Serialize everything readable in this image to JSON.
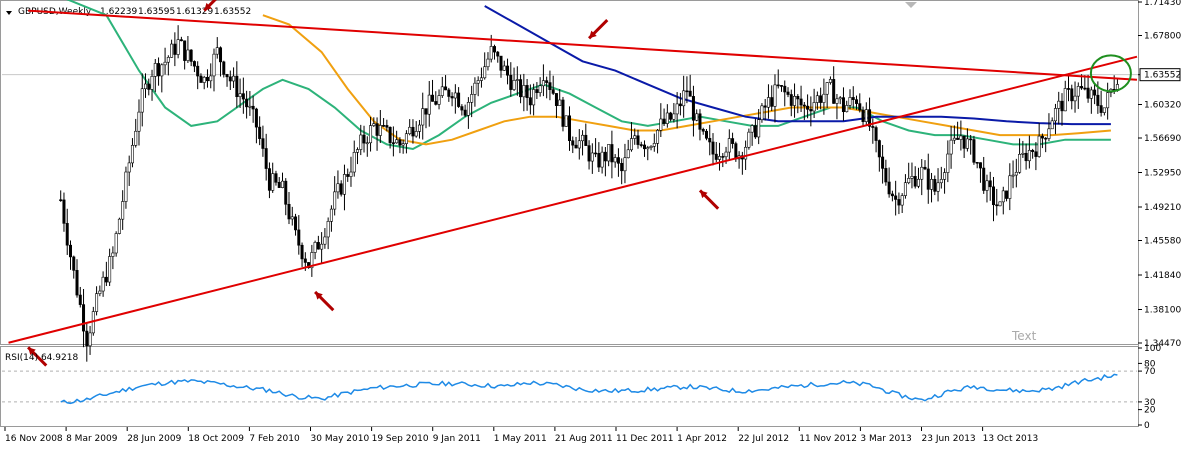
{
  "header": {
    "symbol": "GBPUSD,Weekly",
    "open": "1.62239",
    "high": "1.63595",
    "low": "1.61329",
    "close": "1.63552",
    "watermark": "Text"
  },
  "colors": {
    "background": "#ffffff",
    "bull_candle": "#000000",
    "bear_candle": "#000000",
    "trendline": "#e00000",
    "ma_fast": "#2db37a",
    "ma_mid": "#f0a010",
    "ma_slow": "#0a1aa8",
    "rsi_line": "#1e8ae6",
    "arrow": "#b00000",
    "highlight_circle": "#1f8f1f",
    "price_marker": "#ffffff"
  },
  "chart_data": [
    {
      "type": "candlestick",
      "title": "GBPUSD,Weekly",
      "ohlc_header": {
        "open": 1.62239,
        "high": 1.63595,
        "low": 1.61329,
        "close": 1.63552
      },
      "ylim": [
        1.3447,
        1.7143
      ],
      "y_ticks": [
        "1.71430",
        "1.67800",
        "1.63552",
        "1.60320",
        "1.56690",
        "1.52950",
        "1.49210",
        "1.45580",
        "1.41840",
        "1.38100",
        "1.34470"
      ],
      "current_price_label": "1.63552",
      "x_ticks": [
        "16 Nov 2008",
        "8 Mar 2009",
        "28 Jun 2009",
        "18 Oct 2009",
        "7 Feb 2010",
        "30 May 2010",
        "19 Sep 2010",
        "9 Jan 2011",
        "1 May 2011",
        "21 Aug 2011",
        "11 Dec 2011",
        "1 Apr 2012",
        "22 Jul 2012",
        "11 Nov 2012",
        "3 Mar 2013",
        "23 Jun 2013",
        "13 Oct 2013"
      ],
      "price_path": [
        [
          0,
          1.5
        ],
        [
          4,
          1.42
        ],
        [
          8,
          1.35
        ],
        [
          12,
          1.4
        ],
        [
          16,
          1.44
        ],
        [
          20,
          1.52
        ],
        [
          24,
          1.6
        ],
        [
          28,
          1.64
        ],
        [
          32,
          1.65
        ],
        [
          36,
          1.67
        ],
        [
          40,
          1.65
        ],
        [
          44,
          1.63
        ],
        [
          48,
          1.66
        ],
        [
          52,
          1.63
        ],
        [
          56,
          1.61
        ],
        [
          60,
          1.58
        ],
        [
          64,
          1.52
        ],
        [
          68,
          1.51
        ],
        [
          72,
          1.46
        ],
        [
          76,
          1.43
        ],
        [
          80,
          1.46
        ],
        [
          84,
          1.5
        ],
        [
          88,
          1.53
        ],
        [
          92,
          1.56
        ],
        [
          96,
          1.58
        ],
        [
          100,
          1.57
        ],
        [
          104,
          1.56
        ],
        [
          108,
          1.58
        ],
        [
          112,
          1.6
        ],
        [
          116,
          1.61
        ],
        [
          120,
          1.62
        ],
        [
          124,
          1.6
        ],
        [
          128,
          1.63
        ],
        [
          132,
          1.66
        ],
        [
          136,
          1.64
        ],
        [
          140,
          1.62
        ],
        [
          144,
          1.61
        ],
        [
          148,
          1.64
        ],
        [
          152,
          1.61
        ],
        [
          156,
          1.57
        ],
        [
          160,
          1.56
        ],
        [
          164,
          1.54
        ],
        [
          168,
          1.55
        ],
        [
          172,
          1.53
        ],
        [
          176,
          1.57
        ],
        [
          180,
          1.56
        ],
        [
          184,
          1.58
        ],
        [
          188,
          1.59
        ],
        [
          192,
          1.62
        ],
        [
          196,
          1.57
        ],
        [
          200,
          1.55
        ],
        [
          204,
          1.56
        ],
        [
          208,
          1.55
        ],
        [
          212,
          1.57
        ],
        [
          216,
          1.6
        ],
        [
          220,
          1.62
        ],
        [
          224,
          1.61
        ],
        [
          228,
          1.6
        ],
        [
          232,
          1.61
        ],
        [
          236,
          1.62
        ],
        [
          240,
          1.6
        ],
        [
          244,
          1.61
        ],
        [
          248,
          1.58
        ],
        [
          252,
          1.53
        ],
        [
          256,
          1.5
        ],
        [
          260,
          1.52
        ],
        [
          264,
          1.53
        ],
        [
          268,
          1.51
        ],
        [
          272,
          1.55
        ],
        [
          276,
          1.57
        ],
        [
          280,
          1.55
        ],
        [
          284,
          1.51
        ],
        [
          288,
          1.49
        ],
        [
          292,
          1.53
        ],
        [
          296,
          1.55
        ],
        [
          300,
          1.56
        ],
        [
          304,
          1.59
        ],
        [
          308,
          1.61
        ],
        [
          312,
          1.62
        ],
        [
          316,
          1.61
        ],
        [
          320,
          1.6
        ],
        [
          324,
          1.6355
        ]
      ],
      "series": [
        {
          "name": "ma_fast",
          "points": [
            [
              0,
              1.72
            ],
            [
              14,
              1.7
            ],
            [
              24,
              1.64
            ],
            [
              32,
              1.6
            ],
            [
              40,
              1.58
            ],
            [
              48,
              1.585
            ],
            [
              56,
              1.605
            ],
            [
              62,
              1.62
            ],
            [
              68,
              1.63
            ],
            [
              76,
              1.62
            ],
            [
              84,
              1.6
            ],
            [
              92,
              1.575
            ],
            [
              100,
              1.56
            ],
            [
              108,
              1.555
            ],
            [
              116,
              1.57
            ],
            [
              124,
              1.59
            ],
            [
              132,
              1.605
            ],
            [
              140,
              1.615
            ],
            [
              148,
              1.625
            ],
            [
              156,
              1.615
            ],
            [
              164,
              1.6
            ],
            [
              172,
              1.585
            ],
            [
              180,
              1.58
            ],
            [
              188,
              1.585
            ],
            [
              196,
              1.59
            ],
            [
              204,
              1.585
            ],
            [
              212,
              1.58
            ],
            [
              220,
              1.58
            ],
            [
              228,
              1.59
            ],
            [
              236,
              1.6
            ],
            [
              244,
              1.6
            ],
            [
              252,
              1.585
            ],
            [
              260,
              1.575
            ],
            [
              268,
              1.57
            ],
            [
              276,
              1.57
            ],
            [
              284,
              1.565
            ],
            [
              292,
              1.56
            ],
            [
              300,
              1.56
            ],
            [
              308,
              1.565
            ],
            [
              316,
              1.565
            ],
            [
              322,
              1.565
            ]
          ]
        },
        {
          "name": "ma_mid",
          "points": [
            [
              62,
              1.7
            ],
            [
              70,
              1.69
            ],
            [
              80,
              1.66
            ],
            [
              88,
              1.62
            ],
            [
              96,
              1.585
            ],
            [
              104,
              1.565
            ],
            [
              112,
              1.56
            ],
            [
              120,
              1.565
            ],
            [
              128,
              1.575
            ],
            [
              136,
              1.585
            ],
            [
              144,
              1.59
            ],
            [
              152,
              1.59
            ],
            [
              160,
              1.585
            ],
            [
              168,
              1.58
            ],
            [
              176,
              1.575
            ],
            [
              184,
              1.575
            ],
            [
              192,
              1.58
            ],
            [
              200,
              1.585
            ],
            [
              208,
              1.59
            ],
            [
              216,
              1.595
            ],
            [
              224,
              1.6
            ],
            [
              232,
              1.6
            ],
            [
              240,
              1.6
            ],
            [
              248,
              1.595
            ],
            [
              256,
              1.59
            ],
            [
              264,
              1.585
            ],
            [
              272,
              1.58
            ],
            [
              280,
              1.575
            ],
            [
              288,
              1.57
            ],
            [
              296,
              1.57
            ],
            [
              304,
              1.57
            ],
            [
              312,
              1.572
            ],
            [
              322,
              1.575
            ]
          ]
        },
        {
          "name": "ma_slow",
          "points": [
            [
              130,
              1.71
            ],
            [
              140,
              1.69
            ],
            [
              150,
              1.67
            ],
            [
              160,
              1.65
            ],
            [
              170,
              1.64
            ],
            [
              180,
              1.625
            ],
            [
              190,
              1.61
            ],
            [
              200,
              1.6
            ],
            [
              210,
              1.59
            ],
            [
              220,
              1.585
            ],
            [
              230,
              1.585
            ],
            [
              240,
              1.585
            ],
            [
              250,
              1.59
            ],
            [
              260,
              1.59
            ],
            [
              270,
              1.59
            ],
            [
              280,
              1.588
            ],
            [
              290,
              1.585
            ],
            [
              300,
              1.583
            ],
            [
              310,
              1.582
            ],
            [
              322,
              1.582
            ]
          ]
        }
      ],
      "trendlines": [
        {
          "name": "descending_resistance",
          "from": [
            -10,
            1.705
          ],
          "to": [
            330,
            1.63
          ]
        },
        {
          "name": "ascending_support",
          "from": [
            -16,
            1.345
          ],
          "to": [
            330,
            1.655
          ]
        }
      ],
      "annotations": [
        {
          "type": "arrow",
          "at": [
            44,
            1.705
          ],
          "direction": "down-left"
        },
        {
          "type": "arrow",
          "at": [
            162,
            1.675
          ],
          "direction": "down-left"
        },
        {
          "type": "arrow",
          "at": [
            78,
            1.4
          ],
          "direction": "up-right"
        },
        {
          "type": "arrow",
          "at": [
            196,
            1.51
          ],
          "direction": "up-right"
        },
        {
          "type": "arrow",
          "at": [
            -10,
            1.34
          ],
          "direction": "up-right"
        },
        {
          "type": "circle",
          "at": [
            322,
            1.637
          ]
        }
      ]
    },
    {
      "type": "line",
      "title": "RSI(14) 64.9218",
      "ylim": [
        0,
        100
      ],
      "y_ticks": [
        "100",
        "80",
        "70",
        "30",
        "20",
        "0"
      ],
      "levels": [
        30,
        70
      ],
      "series": [
        {
          "name": "RSI(14)",
          "values_x": [
            0,
            8,
            16,
            24,
            32,
            40,
            48,
            56,
            64,
            72,
            80,
            88,
            96,
            104,
            112,
            120,
            128,
            136,
            144,
            152,
            160,
            168,
            176,
            184,
            192,
            200,
            208,
            216,
            224,
            232,
            240,
            248,
            256,
            264,
            272,
            280,
            288,
            296,
            304,
            312,
            320,
            324
          ],
          "values": [
            29,
            33,
            42,
            50,
            55,
            57,
            54,
            49,
            45,
            37,
            34,
            42,
            48,
            51,
            53,
            54,
            52,
            50,
            55,
            52,
            46,
            44,
            45,
            47,
            50,
            47,
            44,
            46,
            50,
            53,
            55,
            52,
            40,
            32,
            43,
            50,
            46,
            44,
            47,
            56,
            62,
            64.9218
          ]
        }
      ]
    }
  ]
}
